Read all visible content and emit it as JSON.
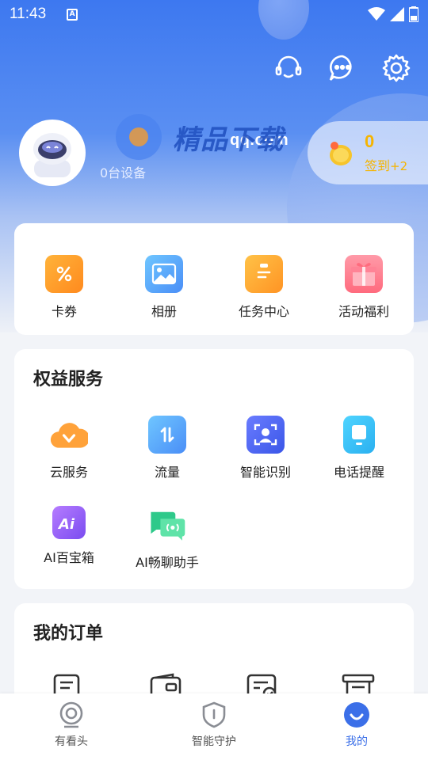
{
  "status": {
    "time": "11:43",
    "badge": "A"
  },
  "profile": {
    "username": "qq.com",
    "devices": "0台设备"
  },
  "watermark": {
    "text": "精品下载"
  },
  "coins": {
    "count": "0",
    "checkin_label": "签到",
    "checkin_bonus": "+2"
  },
  "quick": [
    {
      "label": "卡券"
    },
    {
      "label": "相册"
    },
    {
      "label": "任务中心"
    },
    {
      "label": "活动福利"
    }
  ],
  "benefits": {
    "title": "权益服务",
    "items": [
      {
        "label": "云服务"
      },
      {
        "label": "流量"
      },
      {
        "label": "智能识别"
      },
      {
        "label": "电话提醒"
      },
      {
        "label": "AI百宝箱"
      },
      {
        "label": "AI畅聊助手"
      }
    ]
  },
  "orders": {
    "title": "我的订单"
  },
  "tabs": [
    {
      "label": "有看头"
    },
    {
      "label": "智能守护"
    },
    {
      "label": "我的"
    }
  ],
  "colors": {
    "primary": "#3b6fe8",
    "gold": "#f5b400"
  }
}
